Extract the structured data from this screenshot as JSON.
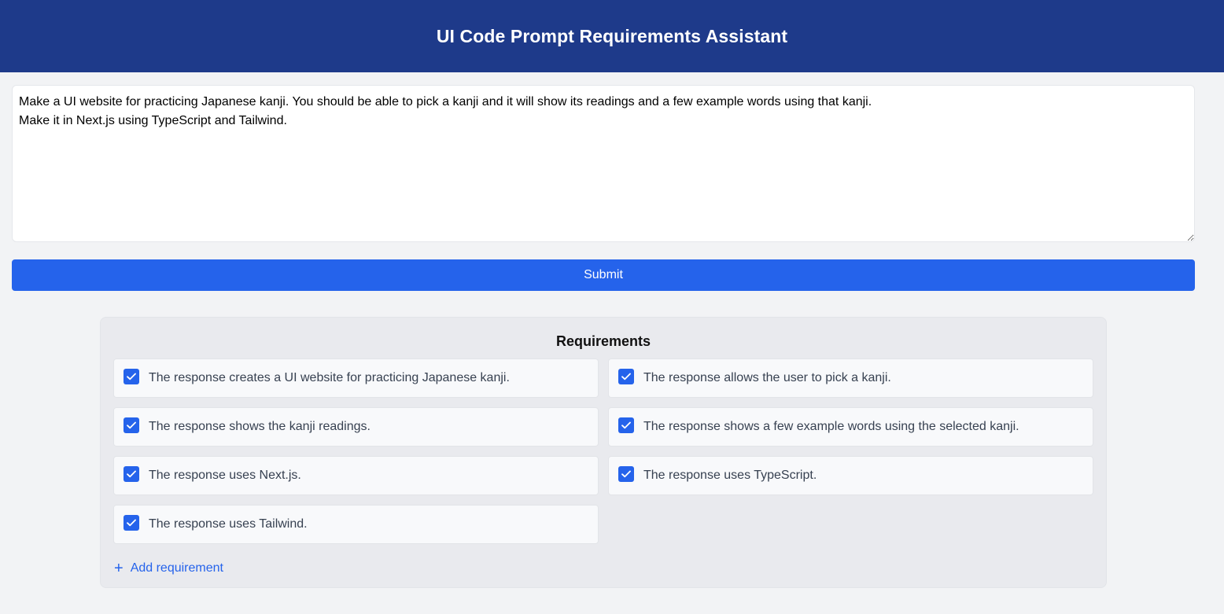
{
  "header": {
    "title": "UI Code Prompt Requirements Assistant"
  },
  "prompt": {
    "value": "Make a UI website for practicing Japanese kanji. You should be able to pick a kanji and it will show its readings and a few example words using that kanji.\nMake it in Next.js using TypeScript and Tailwind."
  },
  "submit": {
    "label": "Submit"
  },
  "requirements": {
    "title": "Requirements",
    "items": [
      {
        "label": "The response creates a UI website for practicing Japanese kanji.",
        "checked": true
      },
      {
        "label": "The response allows the user to pick a kanji.",
        "checked": true
      },
      {
        "label": "The response shows the kanji readings.",
        "checked": true
      },
      {
        "label": "The response shows a few example words using the selected kanji.",
        "checked": true
      },
      {
        "label": "The response uses Next.js.",
        "checked": true
      },
      {
        "label": "The response uses TypeScript.",
        "checked": true
      },
      {
        "label": "The response uses Tailwind.",
        "checked": true
      }
    ],
    "add_label": "Add requirement",
    "add_icon": "plus-icon"
  },
  "colors": {
    "header_bg": "#1e3a8a",
    "accent": "#2563eb",
    "page_bg": "#f2f3f5"
  }
}
